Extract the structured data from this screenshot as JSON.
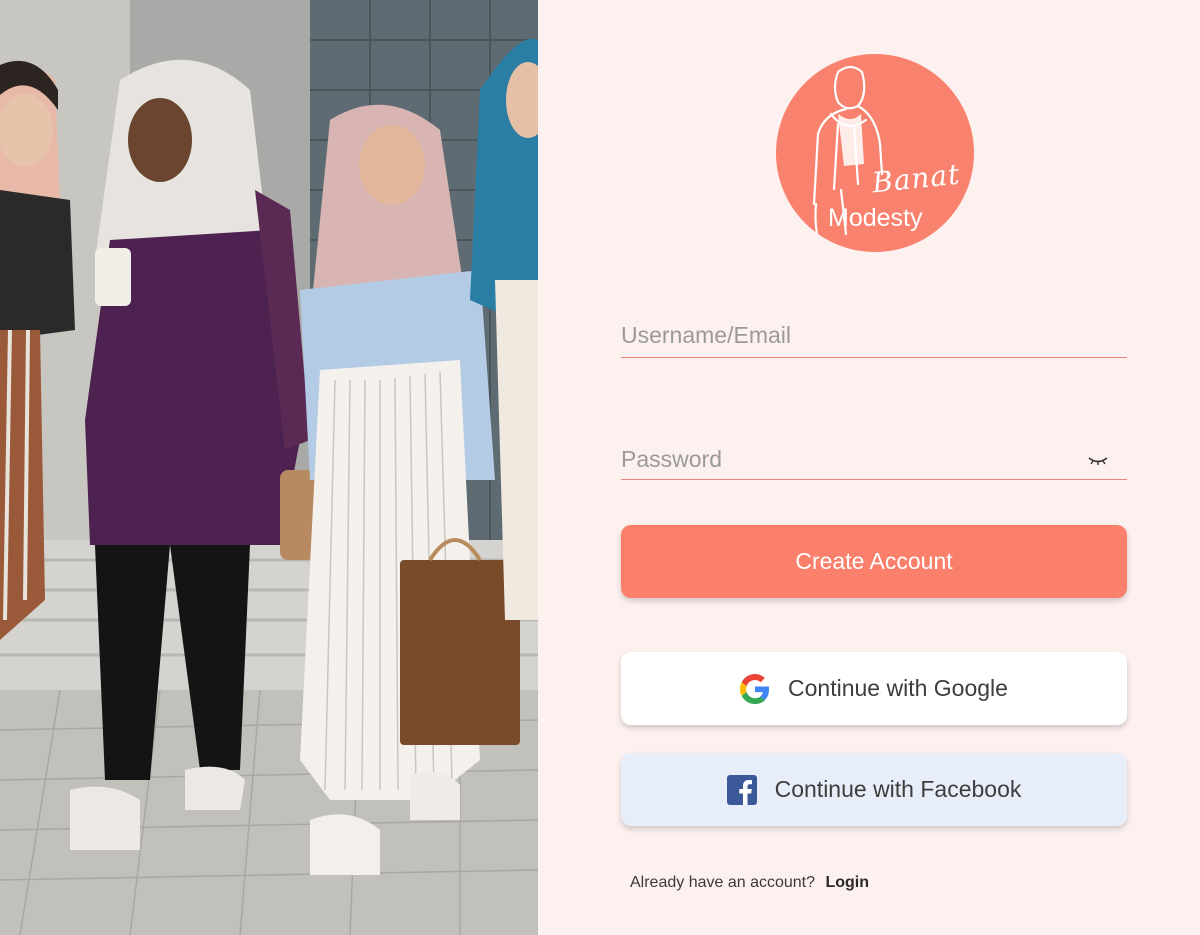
{
  "logo": {
    "script": "Banat",
    "word": "Modesty"
  },
  "form": {
    "username_placeholder": "Username/Email",
    "username_value": "",
    "password_placeholder": "Password",
    "password_value": ""
  },
  "buttons": {
    "create_account": "Create Account",
    "google": "Continue with Google",
    "facebook": "Continue with Facebook"
  },
  "footer": {
    "prompt": "Already have an account?",
    "login": "Login"
  },
  "colors": {
    "accent": "#fa806c",
    "background": "#fdf1ef",
    "facebook": "#3b5998"
  },
  "icons": {
    "password_toggle": "eye-closed-icon",
    "google": "google-icon",
    "facebook": "facebook-icon"
  }
}
